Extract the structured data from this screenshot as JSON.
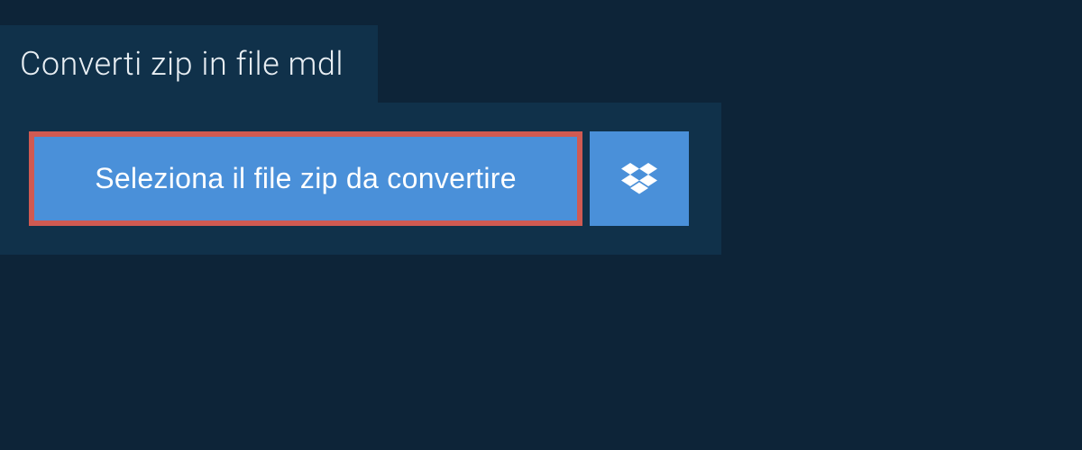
{
  "header": {
    "title": "Converti zip in file mdl"
  },
  "buttons": {
    "select_file_label": "Seleziona il file zip da convertire"
  },
  "colors": {
    "background": "#0d2438",
    "panel": "#10314a",
    "button": "#4a90d9",
    "highlight_border": "#d05a52",
    "text_light": "#e8eef3",
    "text_white": "#ffffff"
  }
}
